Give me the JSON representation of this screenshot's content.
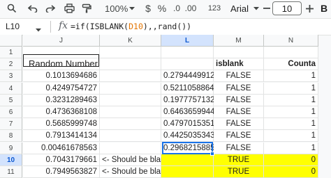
{
  "toolbar": {
    "zoom": "100%",
    "decimal_decrease": ".0",
    "decimal_increase": ".00",
    "more_formats": "123",
    "font_name": "Arial",
    "font_size": "10",
    "icons": [
      "search-icon",
      "undo-icon",
      "redo-icon",
      "print-icon",
      "paint-format-icon",
      "zoom-dropdown-icon",
      "currency-icon",
      "percent-icon",
      "font-dropdown-icon",
      "font-size-decrease-icon",
      "font-size-increase-icon",
      "bold-icon"
    ]
  },
  "formula_bar": {
    "cell_ref": "L10",
    "fx": "fx",
    "formula_prefix": "=if(ISBLANK(",
    "formula_ref": "D10",
    "formula_suffix": "),,rand())"
  },
  "columns": [
    "J",
    "K",
    "L",
    "M",
    "N"
  ],
  "selected_column": "L",
  "rows": [
    "1",
    "2",
    "3",
    "4",
    "5",
    "6",
    "7",
    "8",
    "9",
    "10",
    "11"
  ],
  "selected_row": "10",
  "cells": {
    "J2": "Random Number",
    "M2": "isblank",
    "N2": "Counta",
    "J3": "0.1013694686",
    "L3": "0.2794449912",
    "M3": "FALSE",
    "N3": "1",
    "J4": "0.4249754727",
    "L4": "0.5211058864",
    "M4": "FALSE",
    "N4": "1",
    "J5": "0.3231289463",
    "L5": "0.1977757132",
    "M5": "FALSE",
    "N5": "1",
    "J6": "0.4736368108",
    "L6": "0.6463659944",
    "M6": "FALSE",
    "N6": "1",
    "J7": "0.5685999748",
    "L7": "0.4797015351",
    "M7": "FALSE",
    "N7": "1",
    "J8": "0.7913414134",
    "L8": "0.4425035343",
    "M8": "FALSE",
    "N8": "1",
    "J9": "0.00461678563",
    "L9": "0.2968215885",
    "M9": "FALSE",
    "N9": "1",
    "J10": "0.7043179661",
    "K10": "<- Should be blank",
    "L10": "",
    "M10": "TRUE",
    "N10": "0",
    "J11": "0.7949563827",
    "K11": "<- Should be blank",
    "L11": "",
    "M11": "TRUE",
    "N11": "0"
  },
  "colors": {
    "highlight": "#ffff00",
    "selection_blue": "#1a73e8",
    "header_selected": "#d3e3fd",
    "formula_ref": "#e37400"
  }
}
